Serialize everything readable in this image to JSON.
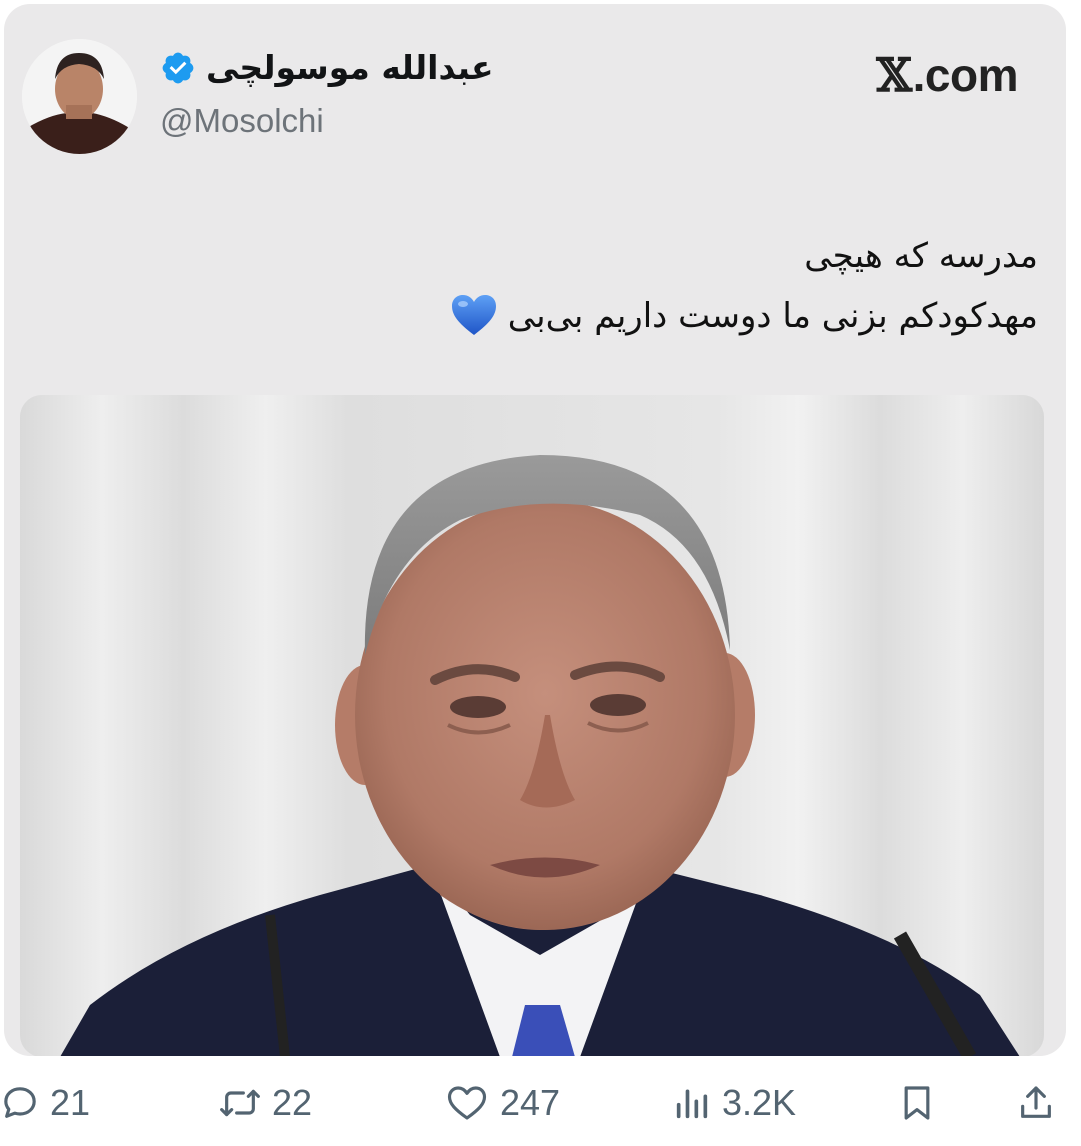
{
  "tweet": {
    "author": {
      "display_name": "عبدالله موسولچی",
      "handle": "@Mosolchi",
      "verified": true
    },
    "site_logo": {
      "glyph": "𝕏",
      "text": ".com"
    },
    "text_lines": [
      "مدرسه که هیچی",
      "مهدکودکم بزنی ما دوست داریم بی‌بی"
    ],
    "emoji": "blue-heart",
    "media": {
      "type": "photo"
    }
  },
  "actions": {
    "replies": "21",
    "reposts": "22",
    "likes": "247",
    "views": "3.2K"
  },
  "colors": {
    "card_background": "#eae9ea",
    "verified_blue": "#1d9bf0",
    "icon_gray": "#536471",
    "heart_blue": "#2d6bdc"
  }
}
